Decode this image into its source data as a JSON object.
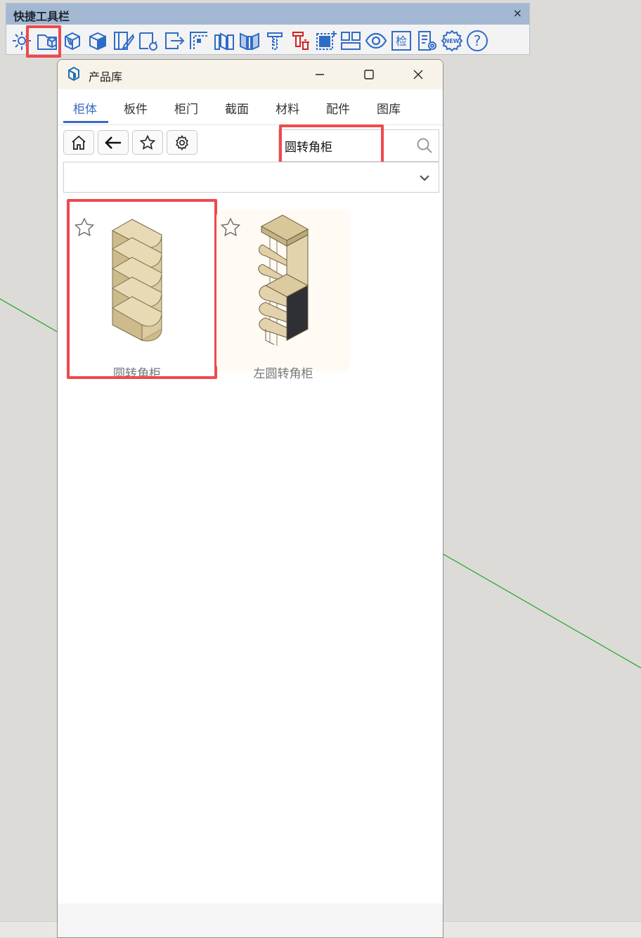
{
  "quick_toolbar": {
    "title": "快捷工具栏",
    "close_glyph": "×",
    "icons": [
      "settings-gear-icon",
      "product-library-icon",
      "panel-hatch-icon",
      "cabinet-box-icon",
      "board-edit-icon",
      "board-rotate-icon",
      "board-export-icon",
      "corner-board-icon",
      "board-split-icon",
      "double-door-icon",
      "screw-icon",
      "delete-hardware-icon",
      "select-frame-icon",
      "grid-layout-icon",
      "eye-icon",
      "检",
      "document-settings-icon",
      "new-badge-icon",
      "help-icon"
    ],
    "inspect_label": "检",
    "new_label": "NEW",
    "help_label": "?"
  },
  "window": {
    "title": "产品库",
    "tabs": [
      {
        "label": "柜体",
        "active": true
      },
      {
        "label": "板件",
        "active": false
      },
      {
        "label": "柜门",
        "active": false
      },
      {
        "label": "截面",
        "active": false
      },
      {
        "label": "材料",
        "active": false
      },
      {
        "label": "配件",
        "active": false
      },
      {
        "label": "图库",
        "active": false
      }
    ],
    "toolbar_buttons": [
      "home-icon",
      "back-arrow-icon",
      "star-icon",
      "gear-icon"
    ],
    "search": {
      "value": "圆转角柜",
      "placeholder": ""
    },
    "filter_dropdown": {
      "selected": ""
    },
    "products": [
      {
        "label": "圆转角柜",
        "favorited": false
      },
      {
        "label": "左圆转角柜",
        "favorited": false
      }
    ]
  },
  "colors": {
    "accent": "#3a6bc3",
    "highlight": "#ee4a4d",
    "toolbar_title_bg": "#a3b8d2",
    "window_title_bg": "#f8f3e9",
    "wood": "#e3d3ad",
    "scene_axis": "#1fa81f"
  }
}
